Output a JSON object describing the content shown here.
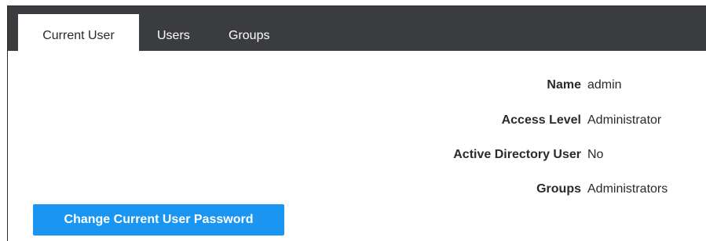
{
  "tabs": [
    {
      "label": "Current User",
      "active": true
    },
    {
      "label": "Users",
      "active": false
    },
    {
      "label": "Groups",
      "active": false
    }
  ],
  "user_info": {
    "name_label": "Name",
    "name_value": "admin",
    "access_level_label": "Access Level",
    "access_level_value": "Administrator",
    "ad_user_label": "Active Directory User",
    "ad_user_value": "No",
    "groups_label": "Groups",
    "groups_value": "Administrators"
  },
  "actions": {
    "change_password_label": "Change Current User Password"
  },
  "colors": {
    "tabbar_bg": "#3b3c3f",
    "button_bg": "#1b95f2"
  }
}
